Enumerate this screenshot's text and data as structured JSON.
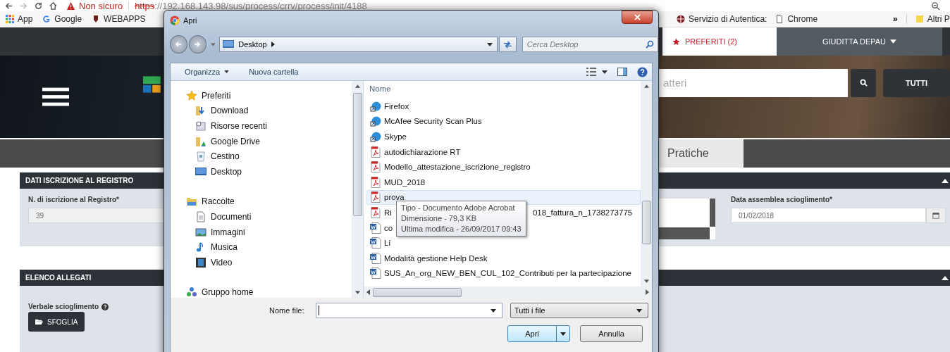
{
  "browser": {
    "security_label": "Non sicuro",
    "url_scheme": "https",
    "url_rest": "://192.168.143.98/sus/process/crrv/process/init/4188",
    "bookmarks_left": [
      {
        "label": "App",
        "kind": "apps"
      },
      {
        "label": "Google",
        "kind": "google"
      },
      {
        "label": "WEBAPPS",
        "kind": "app"
      }
    ],
    "bookmarks_right": [
      {
        "label": "Servizio di Autentica:",
        "kind": "site"
      },
      {
        "label": "Chrome",
        "kind": "page"
      }
    ],
    "more": "»",
    "other_bookmarks": "Altri P"
  },
  "site": {
    "favorites": "PREFERITI (2)",
    "user": "GIUDITTA DEPAU",
    "search_placeholder": "atteri",
    "filter_button": "TUTTI",
    "tabs": [
      {
        "label": "Pratiche",
        "selected": true
      }
    ],
    "panels": [
      {
        "title": "DATI ISCRIZIONE AL REGISTRO",
        "kind": "registry",
        "fields": [
          {
            "label": "N. di iscrizione al Registro*",
            "value": "39"
          },
          {
            "label": "Data assemblea scioglimento*",
            "value": "01/02/2018"
          }
        ]
      },
      {
        "title": "ELENCO ALLEGATI",
        "kind": "attachments",
        "attachment_label": "Verbale scioglimento",
        "browse_button": "SFOGLIA"
      }
    ]
  },
  "dialog": {
    "title": "Apri",
    "breadcrumb": "Desktop",
    "search_placeholder": "Cerca Desktop",
    "organize": "Organizza",
    "new_folder": "Nuova cartella",
    "nav": [
      {
        "label": "Preferiti",
        "kind": "star",
        "children": [
          {
            "label": "Download",
            "kind": "download"
          },
          {
            "label": "Risorse recenti",
            "kind": "recent"
          },
          {
            "label": "Google Drive",
            "kind": "drive"
          },
          {
            "label": "Cestino",
            "kind": "bin"
          },
          {
            "label": "Desktop",
            "kind": "desktop"
          }
        ]
      },
      {
        "label": "Raccolte",
        "kind": "libraries",
        "children": [
          {
            "label": "Documenti",
            "kind": "documents"
          },
          {
            "label": "Immagini",
            "kind": "pictures"
          },
          {
            "label": "Musica",
            "kind": "music"
          },
          {
            "label": "Video",
            "kind": "video"
          }
        ]
      },
      {
        "label": "Gruppo home",
        "kind": "homegroup"
      }
    ],
    "column": "Nome",
    "files": [
      {
        "name": "Firefox",
        "kind": "shortcut",
        "selected": false
      },
      {
        "name": "McAfee Security Scan Plus",
        "kind": "shortcut",
        "selected": false
      },
      {
        "name": "Skype",
        "kind": "shortcut",
        "selected": false
      },
      {
        "name": "autodichiarazione RT",
        "kind": "pdf",
        "selected": false
      },
      {
        "name": "Modello_attestazione_iscrizione_registro",
        "kind": "pdf",
        "selected": false
      },
      {
        "name": "MUD_2018",
        "kind": "pdf",
        "selected": false
      },
      {
        "name": "prova",
        "kind": "pdf",
        "selected": true
      },
      {
        "name": "Ri",
        "tail": "018_fattura_n_1738273775",
        "kind": "pdf",
        "selected": false
      },
      {
        "name": "co",
        "kind": "word",
        "selected": false
      },
      {
        "name": "Li",
        "kind": "word",
        "selected": false
      },
      {
        "name": "Modalità gestione Help Desk",
        "kind": "word",
        "selected": false
      },
      {
        "name": "SUS_An_org_NEW_BEN_CUL_102_Contributi per la partecipazione",
        "kind": "word",
        "selected": false
      }
    ],
    "tooltip": [
      "Tipo - Documento Adobe Acrobat",
      "Dimensione - 79,3 KB",
      "Ultima modifica - 26/09/2017 09:43"
    ],
    "file_name_label": "Nome file:",
    "file_type": "Tutti i file",
    "open_button": "Apri",
    "cancel_button": "Annulla"
  }
}
